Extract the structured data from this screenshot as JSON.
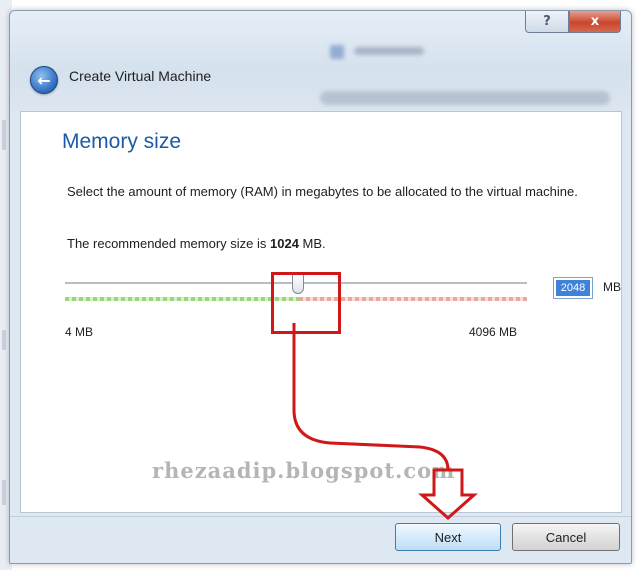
{
  "window": {
    "title": "Create Virtual Machine",
    "help_label": "?",
    "close_label": "x"
  },
  "page": {
    "heading": "Memory size",
    "description": "Select the amount of memory (RAM) in megabytes to be allocated to the virtual machine.",
    "recommend_prefix": "The recommended memory size is ",
    "recommend_value": "1024",
    "recommend_suffix": " MB."
  },
  "memory": {
    "value": "2048",
    "unit": "MB",
    "min_label": "4 MB",
    "max_label": "4096 MB",
    "slider_fraction": 0.5
  },
  "footer": {
    "next_label": "Next",
    "cancel_label": "Cancel"
  },
  "watermark": "rhezaadip.blogspot.com",
  "colors": {
    "heading": "#1c5aa6",
    "annotation": "#d01818",
    "scale_ok": "#9bd67c",
    "scale_warn": "#eba8a0"
  },
  "icons": {
    "back": "back-arrow-icon",
    "help": "help-icon",
    "close": "close-icon"
  }
}
